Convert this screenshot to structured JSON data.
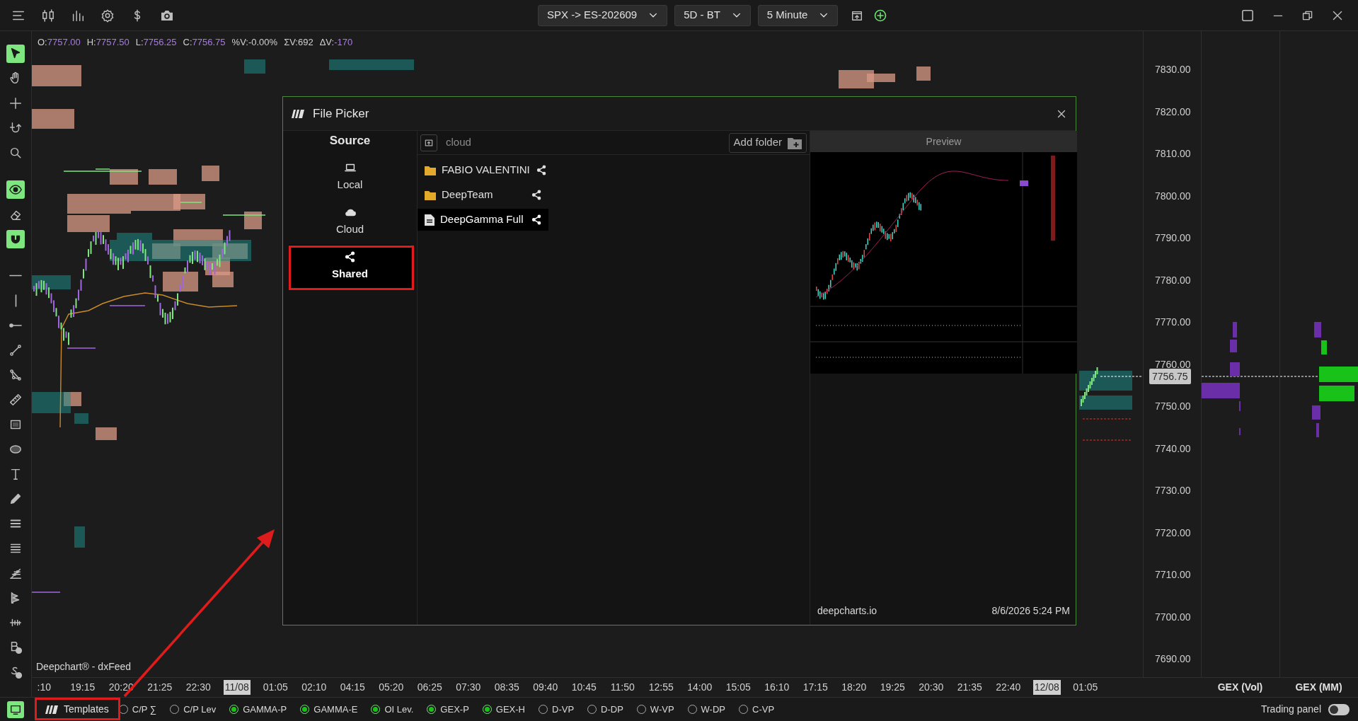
{
  "top_bar": {
    "symbol": "SPX -> ES-202609",
    "range": "5D - BT",
    "interval": "5 Minute"
  },
  "toolbar": {
    "groups": [
      [
        {
          "on": true
        },
        {
          "on": false
        },
        {
          "on": false
        },
        {
          "on": false
        },
        {
          "on": false
        }
      ],
      [
        {
          "on": true
        },
        {
          "on": false
        },
        {
          "on": true
        }
      ],
      [
        {
          "on": false
        },
        {
          "on": false
        },
        {
          "on": false
        },
        {
          "on": false
        },
        {
          "on": false
        },
        {
          "on": false
        },
        {
          "on": false
        },
        {
          "on": false
        },
        {
          "on": false
        },
        {
          "on": false
        },
        {
          "on": false
        },
        {
          "on": false
        },
        {
          "on": false
        },
        {
          "on": false
        },
        {
          "on": false
        },
        {
          "on": false
        },
        {
          "on": false
        }
      ]
    ]
  },
  "ohlc": [
    {
      "label": "O:",
      "value": "7757.00",
      "accent": true
    },
    {
      "label": "H:",
      "value": "7757.50",
      "accent": true
    },
    {
      "label": "L:",
      "value": "7756.25",
      "accent": true
    },
    {
      "label": "C:",
      "value": "7756.75",
      "accent": true
    },
    {
      "label": "%V:",
      "value": "-0.00%",
      "accent": false
    },
    {
      "label": "ΣV:",
      "value": "692",
      "accent": false
    },
    {
      "label": "ΔV:",
      "value": "-170",
      "accent": true
    }
  ],
  "chart": {
    "source_label": "Deepchart® - dxFeed"
  },
  "price_axis": {
    "labels": [
      "7830.00",
      "7820.00",
      "7810.00",
      "7800.00",
      "7790.00",
      "7780.00",
      "7770.00",
      "7760.00",
      "7750.00",
      "7740.00",
      "7730.00",
      "7720.00",
      "7710.00",
      "7700.00",
      "7690.00"
    ],
    "current": "7756.75"
  },
  "time_axis": {
    "labels": [
      {
        "text": ":10",
        "kind": "time"
      },
      {
        "text": "19:15",
        "kind": "time"
      },
      {
        "text": "20:20",
        "kind": "time"
      },
      {
        "text": "21:25",
        "kind": "time"
      },
      {
        "text": "22:30",
        "kind": "time"
      },
      {
        "text": "11/08",
        "kind": "date"
      },
      {
        "text": "01:05",
        "kind": "time"
      },
      {
        "text": "02:10",
        "kind": "time"
      },
      {
        "text": "04:15",
        "kind": "time"
      },
      {
        "text": "05:20",
        "kind": "time"
      },
      {
        "text": "06:25",
        "kind": "time"
      },
      {
        "text": "07:30",
        "kind": "time"
      },
      {
        "text": "08:35",
        "kind": "time"
      },
      {
        "text": "09:40",
        "kind": "time"
      },
      {
        "text": "10:45",
        "kind": "time"
      },
      {
        "text": "11:50",
        "kind": "time"
      },
      {
        "text": "12:55",
        "kind": "time"
      },
      {
        "text": "14:00",
        "kind": "time"
      },
      {
        "text": "15:05",
        "kind": "time"
      },
      {
        "text": "16:10",
        "kind": "time"
      },
      {
        "text": "17:15",
        "kind": "time"
      },
      {
        "text": "18:20",
        "kind": "time"
      },
      {
        "text": "19:25",
        "kind": "time"
      },
      {
        "text": "20:30",
        "kind": "time"
      },
      {
        "text": "21:35",
        "kind": "time"
      },
      {
        "text": "22:40",
        "kind": "time"
      },
      {
        "text": "12/08",
        "kind": "date"
      },
      {
        "text": "01:05",
        "kind": "time"
      }
    ]
  },
  "gex_columns": [
    "GEX (Vol)",
    "GEX (MM)"
  ],
  "file_picker": {
    "title": "File Picker",
    "source": {
      "heading": "Source",
      "items": [
        {
          "label": "Local",
          "selected": false
        },
        {
          "label": "Cloud",
          "selected": false
        },
        {
          "label": "Shared",
          "selected": true
        }
      ]
    },
    "path": "cloud",
    "add_folder": "Add folder",
    "entries": [
      {
        "name": "FABIO VALENTINI",
        "kind": "folder",
        "shared": true,
        "selected": false
      },
      {
        "name": "DeepTeam",
        "kind": "folder",
        "shared": true,
        "selected": false
      },
      {
        "name": "DeepGamma Full",
        "kind": "file",
        "shared": true,
        "selected": true
      }
    ],
    "preview": {
      "heading": "Preview",
      "site": "deepcharts.io",
      "date": "8/6/2026 5:24 PM"
    }
  },
  "bottom_bar": {
    "templates": "Templates",
    "toggles": [
      {
        "label": "C/P ∑",
        "on": false
      },
      {
        "label": "C/P Lev",
        "on": false
      },
      {
        "label": "GAMMA-P",
        "on": true
      },
      {
        "label": "GAMMA-E",
        "on": true
      },
      {
        "label": "OI Lev.",
        "on": true
      },
      {
        "label": "GEX-P",
        "on": true
      },
      {
        "label": "GEX-H",
        "on": true
      },
      {
        "label": "D-VP",
        "on": false
      },
      {
        "label": "D-DP",
        "on": false
      },
      {
        "label": "W-VP",
        "on": false
      },
      {
        "label": "W-DP",
        "on": false
      },
      {
        "label": "C-VP",
        "on": false
      }
    ],
    "trading_panel": {
      "label": "Trading panel",
      "on": false
    }
  }
}
